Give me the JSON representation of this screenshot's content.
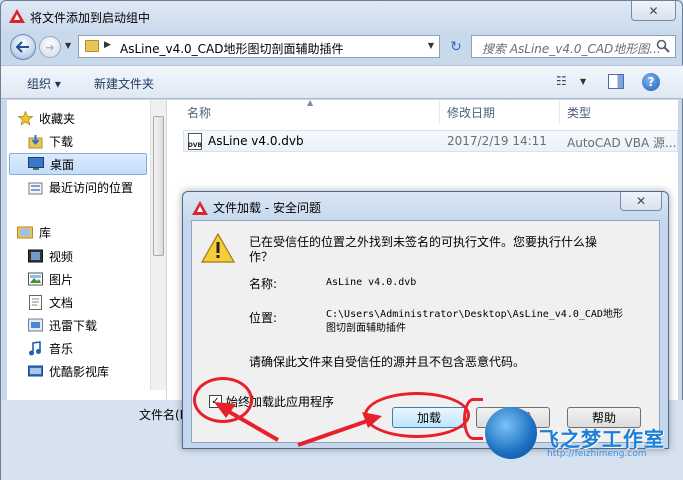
{
  "window": {
    "title": "将文件添加到启动组中",
    "close_glyph": "✕"
  },
  "nav": {
    "address_path": "AsLine_v4.0_CAD地形图切剖面辅助插件",
    "search_placeholder": "搜索 AsLine_v4.0_CAD地形图..."
  },
  "toolbar": {
    "organize": "组织 ▾",
    "new_folder": "新建文件夹"
  },
  "sidebar": {
    "items": [
      {
        "label": "收藏夹",
        "icon": "star-icon"
      },
      {
        "label": "下载",
        "icon": "download-folder-icon"
      },
      {
        "label": "桌面",
        "icon": "desktop-icon"
      },
      {
        "label": "最近访问的位置",
        "icon": "recent-places-icon"
      },
      {
        "label": "库",
        "icon": "library-icon"
      },
      {
        "label": "视频",
        "icon": "video-icon"
      },
      {
        "label": "图片",
        "icon": "pictures-icon"
      },
      {
        "label": "文档",
        "icon": "documents-icon"
      },
      {
        "label": "迅雷下载",
        "icon": "thunder-download-icon"
      },
      {
        "label": "音乐",
        "icon": "music-icon"
      },
      {
        "label": "优酷影视库",
        "icon": "youku-library-icon"
      }
    ]
  },
  "filelist": {
    "columns": [
      "名称",
      "修改日期",
      "类型"
    ],
    "rows": [
      {
        "name": "AsLine v4.0.dvb",
        "date": "2017/2/19 14:11",
        "type": "AutoCAD VBA 源..."
      }
    ]
  },
  "footer": {
    "filename_label": "文件名(N"
  },
  "dialog": {
    "title": "文件加载 - 安全问题",
    "close_glyph": "✕",
    "message": "已在受信任的位置之外找到未签名的可执行文件。您要执行什么操作？",
    "name_label": "名称:",
    "name_value": "AsLine v4.0.dvb",
    "location_label": "位置:",
    "location_value": "C:\\Users\\Administrator\\Desktop\\AsLine_v4.0_CAD地形图切剖面辅助插件",
    "note": "请确保此文件来自受信任的源并且不包含恶意代码。",
    "always_load_label": "始终加载此应用程序",
    "always_load_checked": true,
    "buttons": {
      "load": "加载",
      "cancel": "不加载",
      "help": "帮助"
    }
  },
  "watermark": {
    "text": "飞之梦工作室",
    "url": "http://feizhimeng.com"
  },
  "colors": {
    "annotation_red": "#e8202a",
    "accent_blue": "#1c7fd6"
  }
}
